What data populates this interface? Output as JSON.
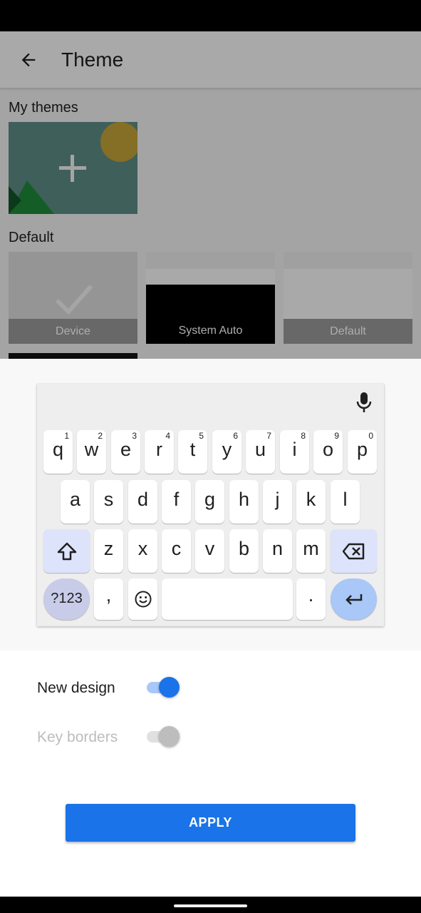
{
  "header": {
    "title": "Theme"
  },
  "themes": {
    "my_themes_label": "My themes",
    "default_label": "Default",
    "tiles": [
      {
        "caption": "Device",
        "selected": true
      },
      {
        "caption": "System Auto"
      },
      {
        "caption": "Default"
      }
    ]
  },
  "keyboard": {
    "row1": [
      {
        "key": "q",
        "hint": "1"
      },
      {
        "key": "w",
        "hint": "2"
      },
      {
        "key": "e",
        "hint": "3"
      },
      {
        "key": "r",
        "hint": "4"
      },
      {
        "key": "t",
        "hint": "5"
      },
      {
        "key": "y",
        "hint": "6"
      },
      {
        "key": "u",
        "hint": "7"
      },
      {
        "key": "i",
        "hint": "8"
      },
      {
        "key": "o",
        "hint": "9"
      },
      {
        "key": "p",
        "hint": "0"
      }
    ],
    "row2": [
      "a",
      "s",
      "d",
      "f",
      "g",
      "h",
      "j",
      "k",
      "l"
    ],
    "row3": [
      "z",
      "x",
      "c",
      "v",
      "b",
      "n",
      "m"
    ],
    "row4": {
      "symbols": "?123",
      "comma": ",",
      "period": "."
    }
  },
  "settings": {
    "new_design": {
      "label": "New design",
      "on": true
    },
    "key_borders": {
      "label": "Key borders",
      "on": false,
      "disabled": true
    }
  },
  "apply_label": "APPLY",
  "colors": {
    "accent": "#1a73e8",
    "toggle_track": "#a8c7fa",
    "keyboard_bg": "#eeeeee"
  },
  "icons": [
    "back-arrow-icon",
    "plus-icon",
    "checkmark-icon",
    "mic-icon",
    "shift-icon",
    "backspace-icon",
    "emoji-icon",
    "enter-icon"
  ]
}
